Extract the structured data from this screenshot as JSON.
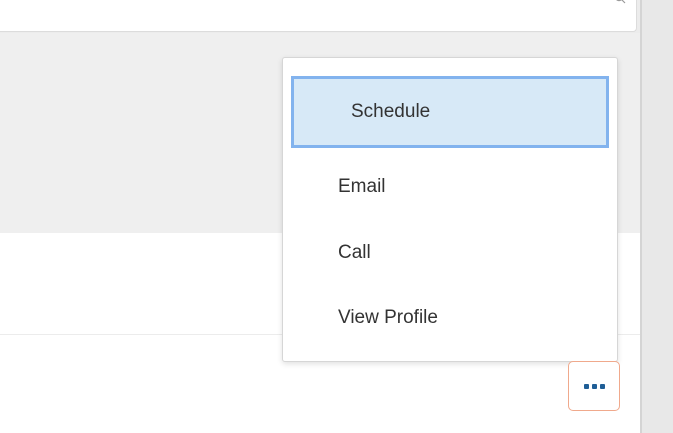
{
  "menu": {
    "items": [
      {
        "label": "Schedule",
        "selected": true
      },
      {
        "label": "Email",
        "selected": false
      },
      {
        "label": "Call",
        "selected": false
      },
      {
        "label": "View Profile",
        "selected": false
      }
    ]
  },
  "more_button": {
    "icon": "ellipsis-icon"
  },
  "colors": {
    "selected_bg": "#d7e9f7",
    "selected_border": "#82b3ee",
    "more_button_border": "#f0a98c",
    "more_dots": "#1f5e96"
  }
}
